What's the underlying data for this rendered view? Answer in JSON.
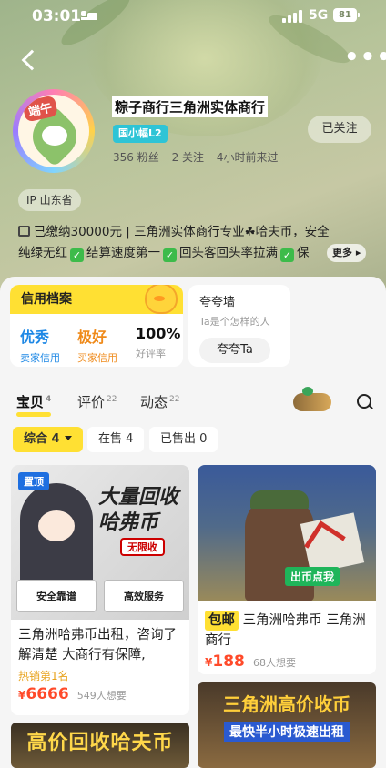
{
  "status_bar": {
    "time": "03:01",
    "network": "5G",
    "battery": "81"
  },
  "header": {
    "back_icon": "chevron-left-icon",
    "more_icon": "more-dots-icon"
  },
  "shop": {
    "avatar_badge": "端午",
    "name": "粽子商行三角洲实体商行",
    "level": "国小幅L2",
    "fans": "356 粉丝",
    "following": "2 关注",
    "last_active": "4小时前来过",
    "follow_label": "已关注"
  },
  "ip": "IP 山东省",
  "description": {
    "line1": "已缴纳30000元 | 三角洲实体商行专业☘哈夫币，安全",
    "line2_a": "纯绿无红",
    "line2_b": "结算速度第一",
    "line2_c": "回头客回头率拉满",
    "line2_d": "保",
    "more_label": "更多"
  },
  "credit": {
    "title": "信用档案",
    "seller_value": "优秀",
    "seller_label": "卖家信用",
    "buyer_value": "极好",
    "buyer_label": "买家信用",
    "rate_value": "100%",
    "rate_label": "好评率",
    "colors": {
      "seller": "#1e88e5",
      "buyer": "#ef8a1a",
      "header": "#ffe033"
    }
  },
  "kuakua": {
    "title": "夸夸墙",
    "subtitle": "Ta是个怎样的人",
    "button": "夸夸Ta"
  },
  "tabs": [
    {
      "label": "宝贝",
      "count": "4"
    },
    {
      "label": "评价",
      "count": "22"
    },
    {
      "label": "动态",
      "count": "22"
    }
  ],
  "filters": [
    {
      "label": "综合 4"
    },
    {
      "label": "在售 4"
    },
    {
      "label": "已售出 0"
    }
  ],
  "products": [
    {
      "pin": "置顶",
      "image_title_1": "大量回收",
      "image_title_2": "哈弗币",
      "image_badge": "无限收",
      "image_row_1": "安全靠谱",
      "image_row_2": "高效服务",
      "title": "三角洲哈弗币出租，咨询了解清楚 大商行有保障,",
      "hot": "热销第1名",
      "currency": "¥",
      "price": "6666",
      "want": "549人想要"
    },
    {
      "image_tag": "出币点我",
      "shipping": "包邮",
      "title": "三角洲哈弗币 三角洲商行",
      "currency": "¥",
      "price": "188",
      "want": "68人想要"
    }
  ],
  "banners": {
    "left": "高价回收哈夫币",
    "right_1": "三角洲高价收币",
    "right_2": "最快半小时极速出租"
  }
}
